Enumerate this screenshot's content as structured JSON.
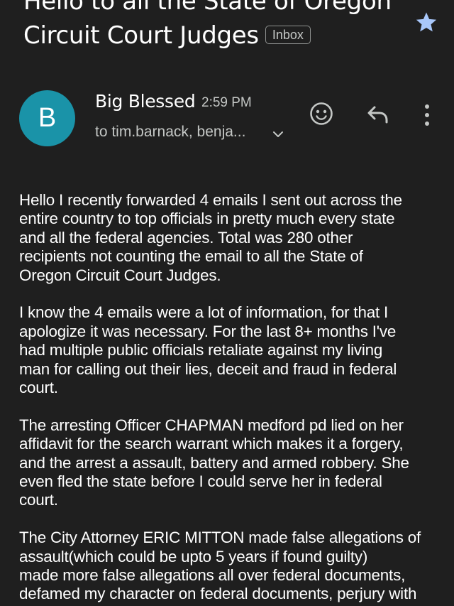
{
  "subject": {
    "line1": "Hello to all the State of Oregon",
    "line2": "Circuit Court Judges",
    "label": "Inbox"
  },
  "sender": {
    "initial": "B",
    "name": "Big Blessed",
    "time": "2:59 PM",
    "recipients": "to tim.barnack, benja..."
  },
  "icons": {
    "star": "star-icon",
    "emoji": "emoji-reaction-icon",
    "reply": "reply-icon",
    "more": "more-vert-icon",
    "expand": "chevron-down-icon"
  },
  "colors": {
    "background": "#1f1f1f",
    "avatar": "#1a93a8",
    "star": "#a8c7fa"
  },
  "body": {
    "paragraphs": [
      "Hello I recently forwarded 4 emails I sent out across the\nentire country to top officials in pretty much every state\nand all the federal agencies. Total was 280 other\nrecipients not counting the email to all the State of\nOregon Circuit Court Judges.",
      "I know the 4 emails were a lot of information, for that I\napologize it was necessary. For the last 8+ months I've\nhad multiple public officials retaliate against my living\nman for calling out their lies, deceit and fraud in federal\ncourt.",
      "The arresting Officer CHAPMAN medford pd lied on her\naffidavit for the search warrant which makes it a forgery,\nand the arrest a assault, battery and armed robbery. She\neven fled the state before I could serve her in federal\ncourt.",
      "The City Attorney ERIC MITTON made false allegations of\nassault(which could be upto 5 years if found guilty)\nmade more false allegations all over federal documents,\ndefamed my character on federal documents, perjury with"
    ]
  }
}
